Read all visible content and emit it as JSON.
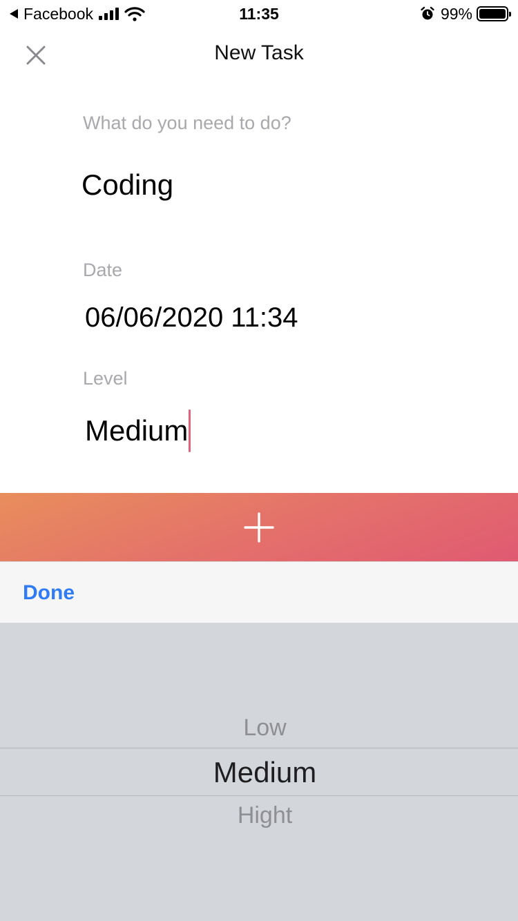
{
  "status_bar": {
    "back_app": "Facebook",
    "time": "11:35",
    "battery": "99%",
    "battery_level": 0.99,
    "icons": [
      "back-arrow-icon",
      "signal-icon",
      "wifi-icon",
      "alarm-icon",
      "battery-icon"
    ]
  },
  "nav": {
    "title": "New Task",
    "close_icon": "close-icon"
  },
  "form": {
    "task_label": "What do you need to do?",
    "task_value": "Coding",
    "date_label": "Date",
    "date_value": "06/06/2020 11:34",
    "level_label": "Level",
    "level_value": "Medium"
  },
  "add_button": {
    "icon": "plus-icon",
    "gradient_colors": [
      "#e88e5c",
      "#e4726a",
      "#e05a72"
    ]
  },
  "picker": {
    "done_label": "Done",
    "done_color": "#2f7cf6",
    "options": [
      "Low",
      "Medium",
      "Hight"
    ],
    "selected": "Medium"
  }
}
